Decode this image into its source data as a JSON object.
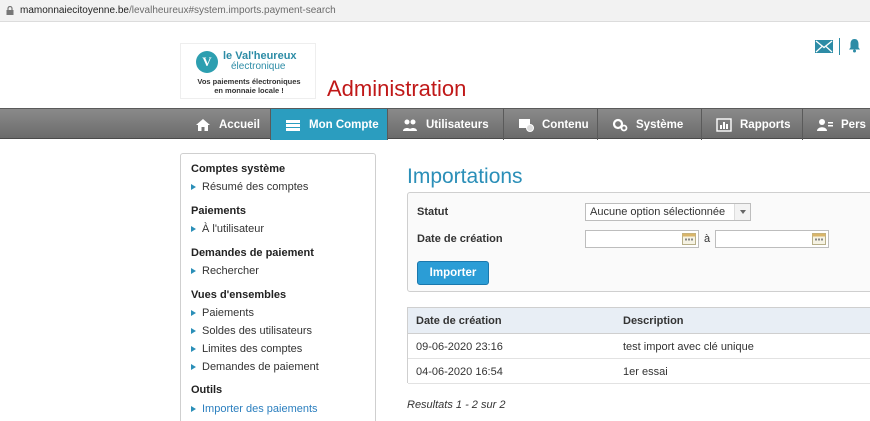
{
  "browser": {
    "url_host": "mamonnaiecitoyenne.be",
    "url_path": "/levalheureux#system.imports.payment-search"
  },
  "header": {
    "brand_line1": "le Val'heureux",
    "brand_line2": "électronique",
    "tagline1": "Vos paiements électroniques",
    "tagline2": "en monnaie locale !",
    "logo_letter": "V",
    "title": "Administration"
  },
  "nav": {
    "items": [
      {
        "label": "Accueil",
        "icon": "home-icon"
      },
      {
        "label": "Mon Compte",
        "icon": "account-icon"
      },
      {
        "label": "Utilisateurs",
        "icon": "users-icon"
      },
      {
        "label": "Contenu",
        "icon": "content-icon"
      },
      {
        "label": "Système",
        "icon": "gears-icon"
      },
      {
        "label": "Rapports",
        "icon": "reports-icon"
      },
      {
        "label": "Pers",
        "icon": "persons-icon"
      }
    ]
  },
  "sidebar": {
    "sections": [
      {
        "title": "Comptes système",
        "links": [
          "Résumé des comptes"
        ]
      },
      {
        "title": "Paiements",
        "links": [
          "À l'utilisateur"
        ]
      },
      {
        "title": "Demandes de paiement",
        "links": [
          "Rechercher"
        ]
      },
      {
        "title": "Vues d'ensembles",
        "links": [
          "Paiements",
          "Soldes des utilisateurs",
          "Limites des comptes",
          "Demandes de paiement"
        ]
      },
      {
        "title": "Outils",
        "links": [
          "Importer des paiements"
        ]
      }
    ]
  },
  "main": {
    "title": "Importations",
    "filters": {
      "status_label": "Statut",
      "status_value": "Aucune option sélectionnée",
      "date_label": "Date de création",
      "date_separator": "à",
      "date_from": "",
      "date_to": ""
    },
    "import_button": "Importer",
    "table": {
      "headers": [
        "Date de création",
        "Description"
      ],
      "rows": [
        [
          "09-06-2020 23:16",
          "test import avec clé unique"
        ],
        [
          "04-06-2020 16:54",
          "1er essai"
        ]
      ]
    },
    "pager": "Resultats 1 - 2 sur 2"
  },
  "colors": {
    "accent": "#2b9dbf",
    "title_red": "#c01818",
    "link_blue": "#2b7fbf"
  }
}
